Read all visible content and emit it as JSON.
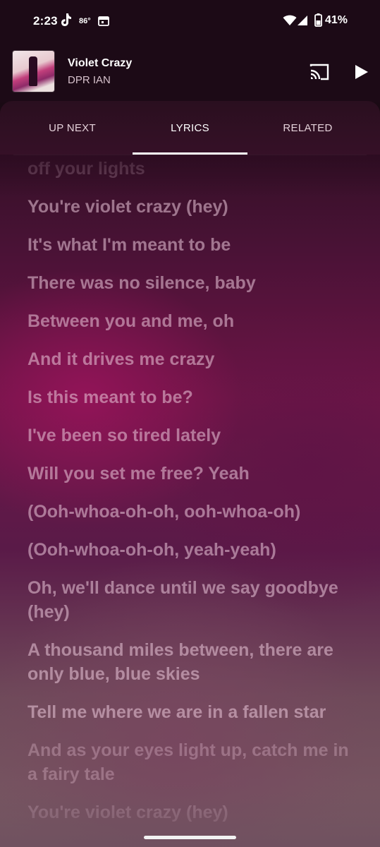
{
  "status_bar": {
    "time": "2:23",
    "temperature": "86°",
    "battery": "41%",
    "icons": [
      "tiktok-icon",
      "calendar-icon",
      "wifi-icon",
      "signal-icon",
      "battery-icon"
    ]
  },
  "player": {
    "title": "Violet Crazy",
    "artist": "DPR IAN",
    "icons": [
      "album-art",
      "cast-icon",
      "play-icon"
    ]
  },
  "tabs": [
    {
      "label": "UP NEXT",
      "active": false
    },
    {
      "label": "LYRICS",
      "active": true
    },
    {
      "label": "RELATED",
      "active": false
    }
  ],
  "lyrics": [
    "off your lights",
    "You're violet crazy (hey)",
    "It's what I'm meant to be",
    "There was no silence, baby",
    "Between you and me, oh",
    "And it drives me crazy",
    "Is this meant to be?",
    "I've been so tired lately",
    "Will you set me free? Yeah",
    "(Ooh-whoa-oh-oh, ooh-whoa-oh)",
    "(Ooh-whoa-oh-oh, yeah-yeah)",
    "Oh, we'll dance until we say goodbye (hey)",
    "A thousand miles between, there are only blue, blue skies",
    "Tell me where we are in a fallen star",
    "And as your eyes light up, catch me in a fairy tale",
    "You're violet crazy (hey)"
  ],
  "colors": {
    "background": "#1c0a16",
    "accent": "#ffffff",
    "lyric_text": "#ebc8da"
  }
}
